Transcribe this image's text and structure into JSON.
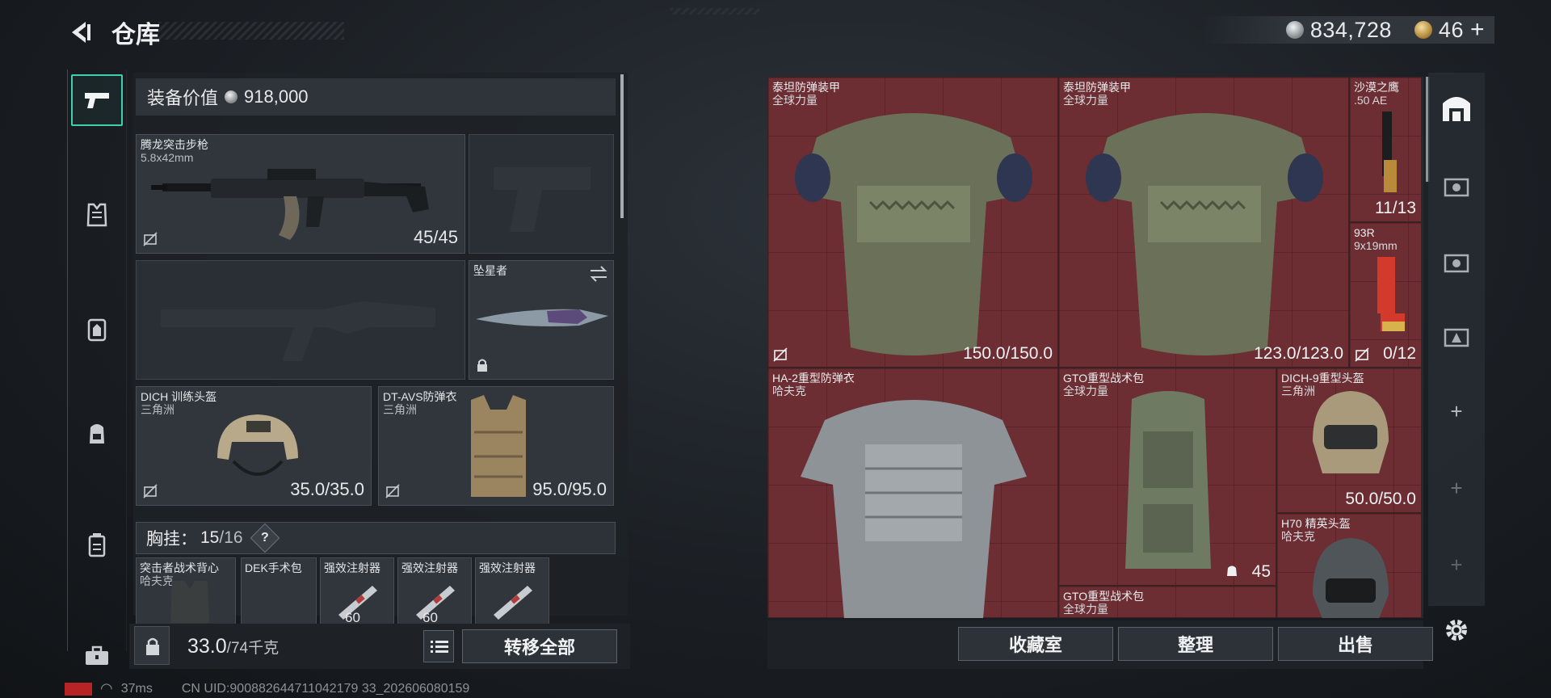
{
  "header": {
    "title": "仓库",
    "silver": "834,728",
    "gold": "46",
    "add": "+"
  },
  "nav": {
    "items": [
      "pistol-icon",
      "armor-vest-icon",
      "chest-rig-icon",
      "backpack-icon",
      "pouch-icon",
      "toolbox-icon"
    ]
  },
  "loadout": {
    "value_label": "装备价值",
    "value": "918,000",
    "slots": {
      "rifle": {
        "name": "腾龙突击步枪",
        "caliber": "5.8x42mm",
        "value": "45/45"
      },
      "melee": {
        "name": "坠星者"
      },
      "helmet": {
        "name": "DICH 训练头盔",
        "brand": "三角洲",
        "value": "35.0/35.0"
      },
      "armor": {
        "name": "DT-AVS防弹衣",
        "brand": "三角洲",
        "value": "95.0/95.0"
      }
    },
    "rig": {
      "label": "胸挂：",
      "used": "15",
      "total": "/16",
      "help": "?"
    },
    "items": [
      {
        "name": "突击者战术背心",
        "brand": "哈夫克"
      },
      {
        "name": "DEK手术包",
        "brand": ""
      },
      {
        "name": "强效注射器",
        "count": "60"
      },
      {
        "name": "强效注射器",
        "count": "60"
      },
      {
        "name": "强效注射器",
        "count": ""
      }
    ],
    "weight": {
      "current": "33.0",
      "max": "/74千克"
    },
    "transfer_all": "转移全部"
  },
  "stash": {
    "cells": [
      {
        "name": "泰坦防弹装甲",
        "sub": "全球力量",
        "value": "150.0/150.0"
      },
      {
        "name": "泰坦防弹装甲",
        "sub": "全球力量",
        "value": "123.0/123.0"
      },
      {
        "name": "沙漠之鹰",
        "sub": ".50 AE",
        "value": "11/13"
      },
      {
        "name": "93R",
        "sub": "9x19mm",
        "value": "0/12"
      },
      {
        "name": "HA-2重型防弹衣",
        "sub": "哈夫克",
        "value": ""
      },
      {
        "name": "GTO重型战术包",
        "sub": "全球力量",
        "value": "45"
      },
      {
        "name": "DICH-9重型头盔",
        "sub": "三角洲",
        "value": "50.0/50.0"
      },
      {
        "name": "H70 精英头盔",
        "sub": "哈夫克",
        "value": ""
      },
      {
        "name": "GTO重型战术包",
        "sub": "全球力量",
        "value": ""
      }
    ],
    "buttons": {
      "collection": "收藏室",
      "sort": "整理",
      "sell": "出售"
    }
  },
  "footer": {
    "ping": "37ms",
    "uid": "CN UID:900882644711042179 33_202606080159"
  },
  "colors": {
    "accent": "#3fd0b0",
    "stash_cell": "#6c2d33"
  }
}
